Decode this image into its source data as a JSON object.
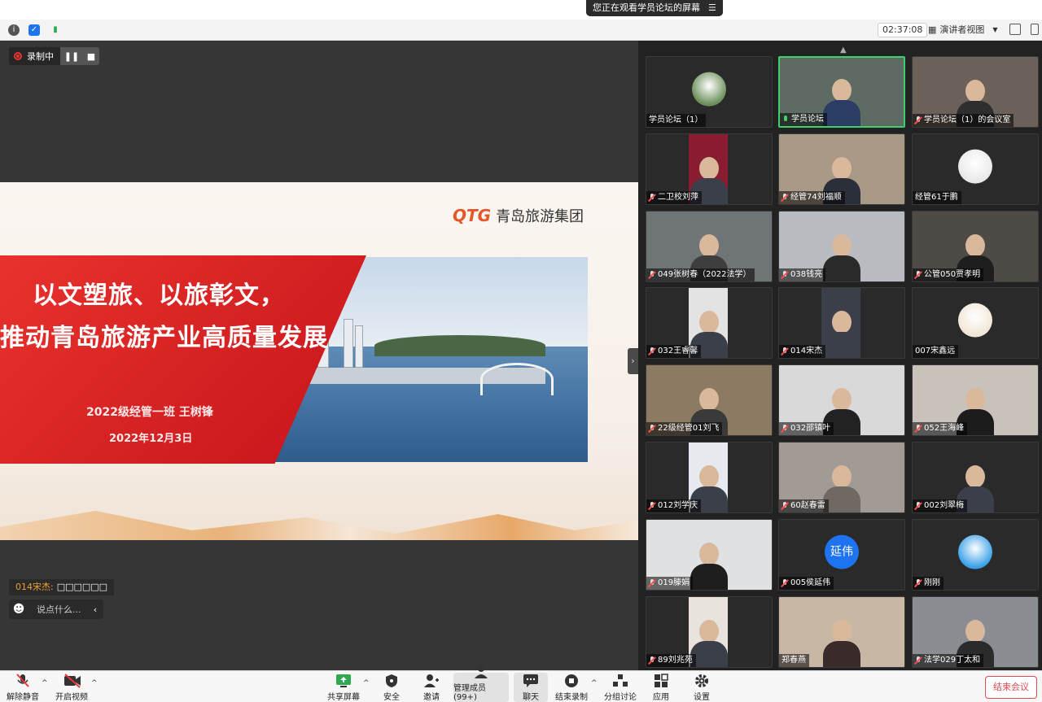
{
  "banner": {
    "text": "您正在观看学员论坛的屏幕"
  },
  "status": {
    "timer": "02:37:08",
    "view_label": "演讲者视图"
  },
  "recording": {
    "label": "录制中"
  },
  "slide": {
    "logo_mark": "QTG",
    "logo_text": "青岛旅游集团",
    "title_line1": "以文塑旅、以旅彰文，",
    "title_line2": "推动青岛旅游产业高质量发展",
    "subtitle1": "2022级经管一班  王树锋",
    "subtitle2": "2022年12月3日"
  },
  "chat": {
    "sender": "014宋杰:",
    "message": "□□□□□□",
    "input_hint": "说点什么..."
  },
  "participants": [
    {
      "name": "学员论坛（1）",
      "kind": "avatar",
      "mic": "none",
      "bg": "#2a2a2a",
      "accent": "#6a8f5a"
    },
    {
      "name": "学员论坛",
      "kind": "video",
      "mic": "live",
      "bg": "#5d6b62",
      "accent": "#2b3d66"
    },
    {
      "name": "学员论坛（1）的会议室",
      "kind": "video",
      "mic": "muted",
      "bg": "#6b6158",
      "accent": "#2e2e2e"
    },
    {
      "name": "二卫校刘萍",
      "kind": "video",
      "mic": "muted",
      "bg": "#2a2a2a",
      "accent": "#8a1c32"
    },
    {
      "name": "经管74刘福顺",
      "kind": "video",
      "mic": "muted",
      "bg": "#a89a86",
      "accent": "#2a2f3a"
    },
    {
      "name": "经管61于鹏",
      "kind": "avatar",
      "mic": "none",
      "bg": "#2a2a2a",
      "accent": "#e8e8e8"
    },
    {
      "name": "049张树春（2022法学）",
      "kind": "video",
      "mic": "muted",
      "bg": "#6f7477",
      "accent": "#3e3e3e"
    },
    {
      "name": "038钱亮",
      "kind": "video",
      "mic": "muted",
      "bg": "#b8bcc0",
      "accent": "#2a2a2a"
    },
    {
      "name": "公管050贾孝明",
      "kind": "video",
      "mic": "muted",
      "bg": "#4e4a46",
      "accent": "#1e1e1e"
    },
    {
      "name": "032王睿馨",
      "kind": "video",
      "mic": "muted",
      "bg": "#2a2a2a",
      "accent": "#e3e3e3"
    },
    {
      "name": "014宋杰",
      "kind": "video",
      "mic": "muted",
      "bg": "#2a2a2a",
      "accent": "#3a3f4a"
    },
    {
      "name": "007宋鑫远",
      "kind": "avatar",
      "mic": "none",
      "bg": "#2a2a2a",
      "accent": "#f1e6d6"
    },
    {
      "name": "22级经管01刘飞",
      "kind": "video",
      "mic": "muted",
      "bg": "#8d7a62",
      "accent": "#3a3a3a"
    },
    {
      "name": "032邵镇叶",
      "kind": "video",
      "mic": "muted",
      "bg": "#d9d9d9",
      "accent": "#222222"
    },
    {
      "name": "052王海峰",
      "kind": "video",
      "mic": "muted",
      "bg": "#c9c2ba",
      "accent": "#1c1c1c"
    },
    {
      "name": "012刘学庆",
      "kind": "video",
      "mic": "muted",
      "bg": "#2a2a2a",
      "accent": "#e6eaee"
    },
    {
      "name": "60赵春雷",
      "kind": "video",
      "mic": "muted",
      "bg": "#a29a94",
      "accent": "#6f6863"
    },
    {
      "name": "002刘翠梅",
      "kind": "video",
      "mic": "muted",
      "bg": "#2a2a2a",
      "accent": "#2a2a2a"
    },
    {
      "name": "019滕娟",
      "kind": "video",
      "mic": "muted",
      "bg": "#dfe1e2",
      "accent": "#1e1e1e"
    },
    {
      "name": "005侯延伟",
      "kind": "initials",
      "initials": "延伟",
      "mic": "muted",
      "bg": "#2a2a2a",
      "accent": "#1e74f0"
    },
    {
      "name": "刚刚",
      "kind": "avatar",
      "mic": "muted",
      "bg": "#2a2a2a",
      "accent": "#3aa0e8"
    },
    {
      "name": "89刘兆苑",
      "kind": "video",
      "mic": "muted",
      "bg": "#2a2a2a",
      "accent": "#e8e4dd"
    },
    {
      "name": "郑春燕",
      "kind": "video",
      "mic": "none",
      "bg": "#c9b7a6",
      "accent": "#3a2a2a"
    },
    {
      "name": "法学029丁太和",
      "kind": "video",
      "mic": "muted",
      "bg": "#8a8e92",
      "accent": "#2b2b2b"
    }
  ],
  "toolbar": {
    "unmute": "解除静音",
    "start_video": "开启视频",
    "share_screen": "共享屏幕",
    "security": "安全",
    "invite": "邀请",
    "members": "管理成员(99+)",
    "chat": "聊天",
    "end_record": "结束录制",
    "breakout": "分组讨论",
    "apps": "应用",
    "settings": "设置",
    "end_meeting": "结束会议"
  }
}
